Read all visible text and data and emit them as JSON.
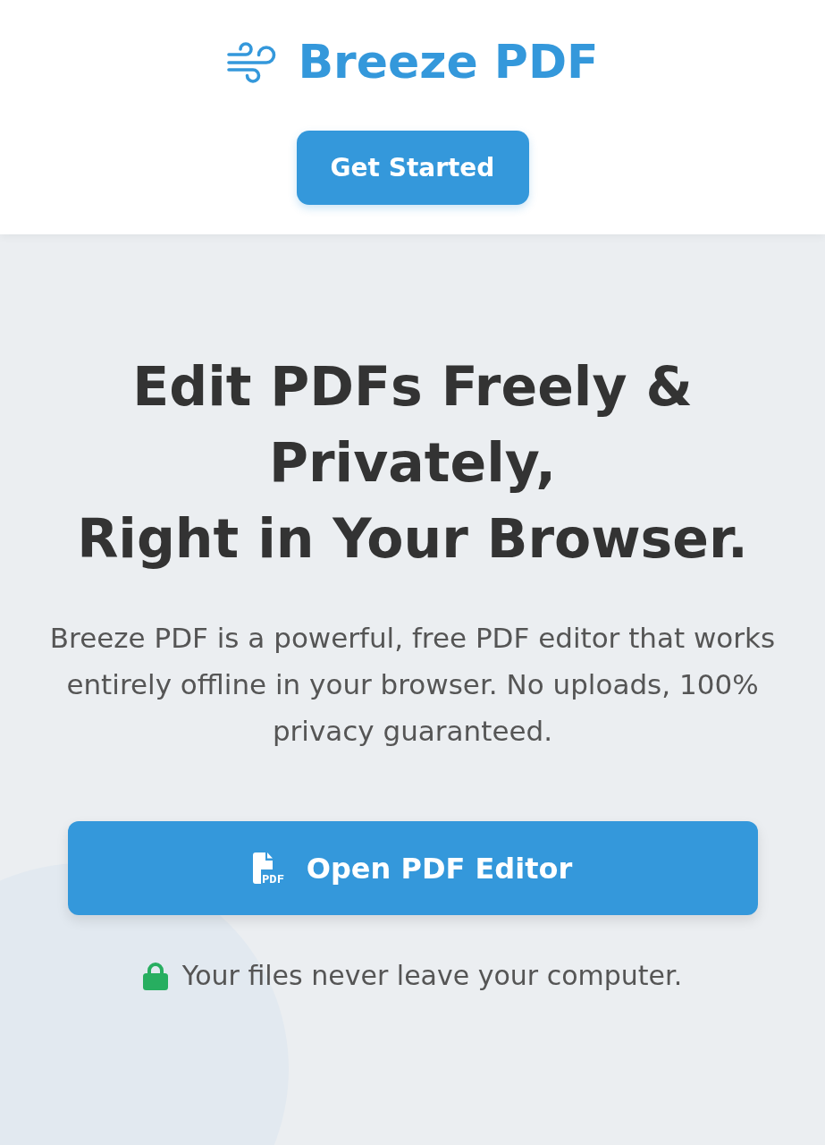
{
  "brand": {
    "name": "Breeze PDF"
  },
  "header": {
    "button": "Get Started"
  },
  "hero": {
    "headline_lines": [
      "Edit PDFs Freely & Privately,",
      "Right in Your Browser."
    ],
    "description": "Breeze PDF is a powerful, free PDF editor that works entirely offline in your browser. No uploads, 100% privacy guaranteed.",
    "cta": {
      "label": "Open PDF Editor",
      "icon_text": "PDF"
    },
    "note": "Your files never leave your computer."
  }
}
